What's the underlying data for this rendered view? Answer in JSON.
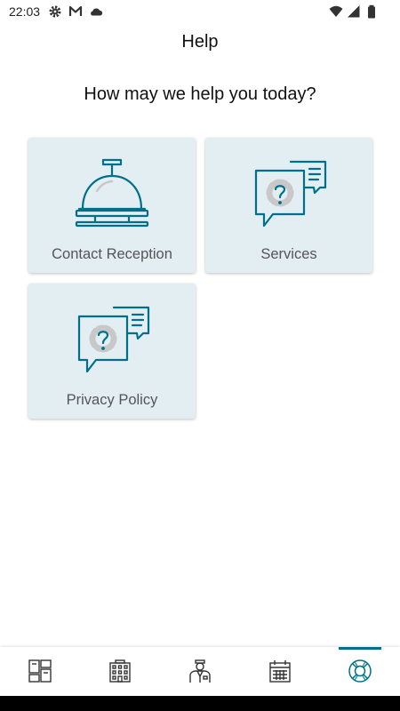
{
  "status_bar": {
    "time": "22:03",
    "icons": [
      "gear-icon",
      "gmail-icon",
      "cloud-icon",
      "wifi-icon",
      "signal-icon",
      "battery-icon"
    ]
  },
  "header": {
    "title": "Help",
    "subtitle": "How may we help you today?"
  },
  "cards": [
    {
      "label": "Contact Reception",
      "icon": "reception-bell-icon"
    },
    {
      "label": "Services",
      "icon": "question-chat-icon"
    },
    {
      "label": "Privacy Policy",
      "icon": "question-chat-icon"
    }
  ],
  "bottom_nav": {
    "items": [
      {
        "icon": "dashboard-icon",
        "active": false
      },
      {
        "icon": "hotel-building-icon",
        "active": false
      },
      {
        "icon": "concierge-icon",
        "active": false
      },
      {
        "icon": "calendar-icon",
        "active": false
      },
      {
        "icon": "lifebuoy-icon",
        "active": true
      }
    ]
  },
  "colors": {
    "accent": "#00708a",
    "card_bg": "#e3eef3",
    "gear_gray": "#c8c8c8"
  }
}
